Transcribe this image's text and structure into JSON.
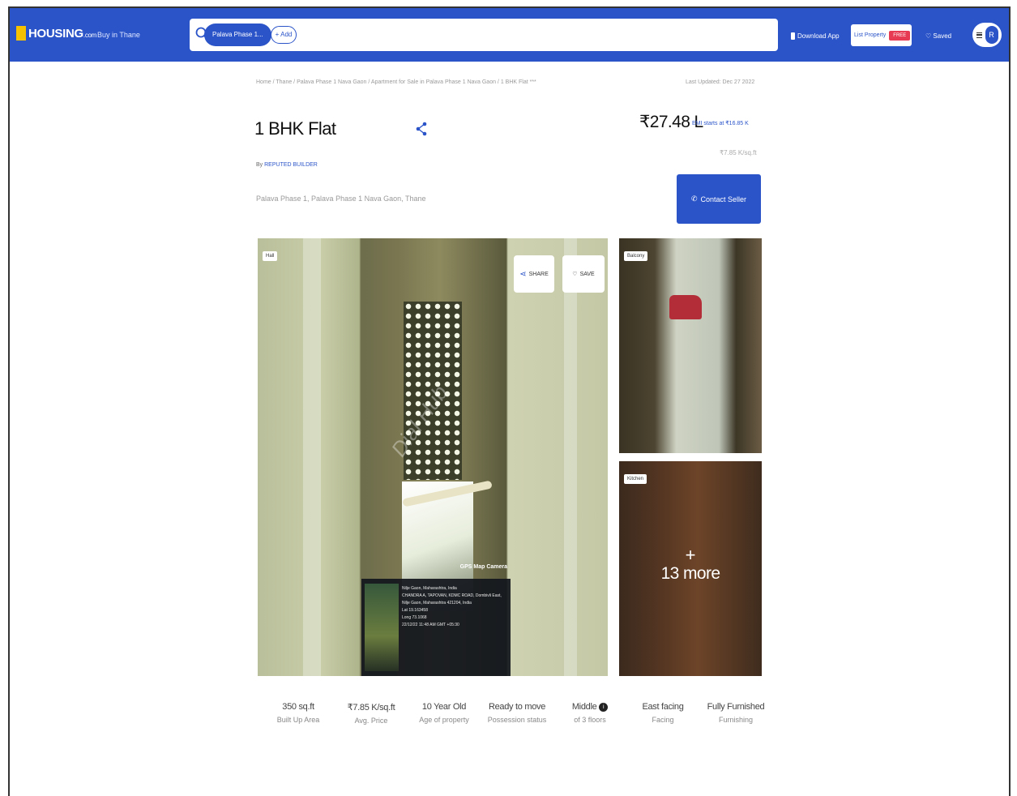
{
  "header": {
    "logo": "HOUSING",
    "logo_suffix": ".com",
    "city_selector": "Buy in Thane",
    "search_chip": "Palava Phase 1...",
    "add_chip": "+ Add",
    "download_app": "Download App",
    "list_property": "List Property",
    "free_badge": "FREE",
    "saved": "Saved",
    "avatar_initial": "R"
  },
  "breadcrumb": "Home / Thane / Palava Phase 1 Nava Gaon / Apartment for Sale in Palava Phase 1 Nava Gaon / 1 BHK Flat ***",
  "last_updated": "Last Updated: Dec 27 2022",
  "listing": {
    "title": "1 BHK Flat",
    "by_prefix": "By",
    "builder": "REPUTED BUILDER",
    "locality": "Palava Phase 1, Palava Phase 1 Nava Gaon, Thane",
    "price": "₹27.48 L",
    "emi": "EMI starts at ₹16.85 K",
    "price_per_sqft": "₹7.85 K/sq.ft",
    "contact_button": "Contact Seller"
  },
  "gallery": {
    "main_badge": "Hall",
    "share_label": "SHARE",
    "save_label": "SAVE",
    "gps_title": "GPS Map Camera",
    "gps_lines": [
      "Nilje Gaon, Maharashtra, India",
      "CHANDRA A, TAPOVAN, KDMC ROAD, Dombivli East,",
      "Nilje Gaon, Maharashtra 421204, India",
      "Lat 19.163458",
      "Long 73.1068",
      "22/12/22 11:48 AM GMT +05:30"
    ],
    "side_top_badge": "Balcony",
    "side_bottom_badge": "Kitchen",
    "more_plus": "+",
    "more_count": "13 more",
    "watermark": "Dial Hub"
  },
  "stats": [
    {
      "value": "350 sq.ft",
      "label": "Built Up Area"
    },
    {
      "value": "₹7.85 K/sq.ft",
      "label": "Avg. Price"
    },
    {
      "value": "10 Year Old",
      "label": "Age of property"
    },
    {
      "value": "Ready to move",
      "label": "Possession status"
    },
    {
      "value": "Middle",
      "label": "of 3 floors"
    },
    {
      "value": "East facing",
      "label": "Facing"
    },
    {
      "value": "Fully Furnished",
      "label": "Furnishing"
    }
  ],
  "colors": {
    "brand": "#2b54c9",
    "free_badge": "#e63b52",
    "logo_mark": "#f6c200"
  },
  "icons": [
    "search-icon",
    "share-icon",
    "heart-icon",
    "phone-icon",
    "info-icon",
    "menu-icon",
    "download-icon"
  ]
}
